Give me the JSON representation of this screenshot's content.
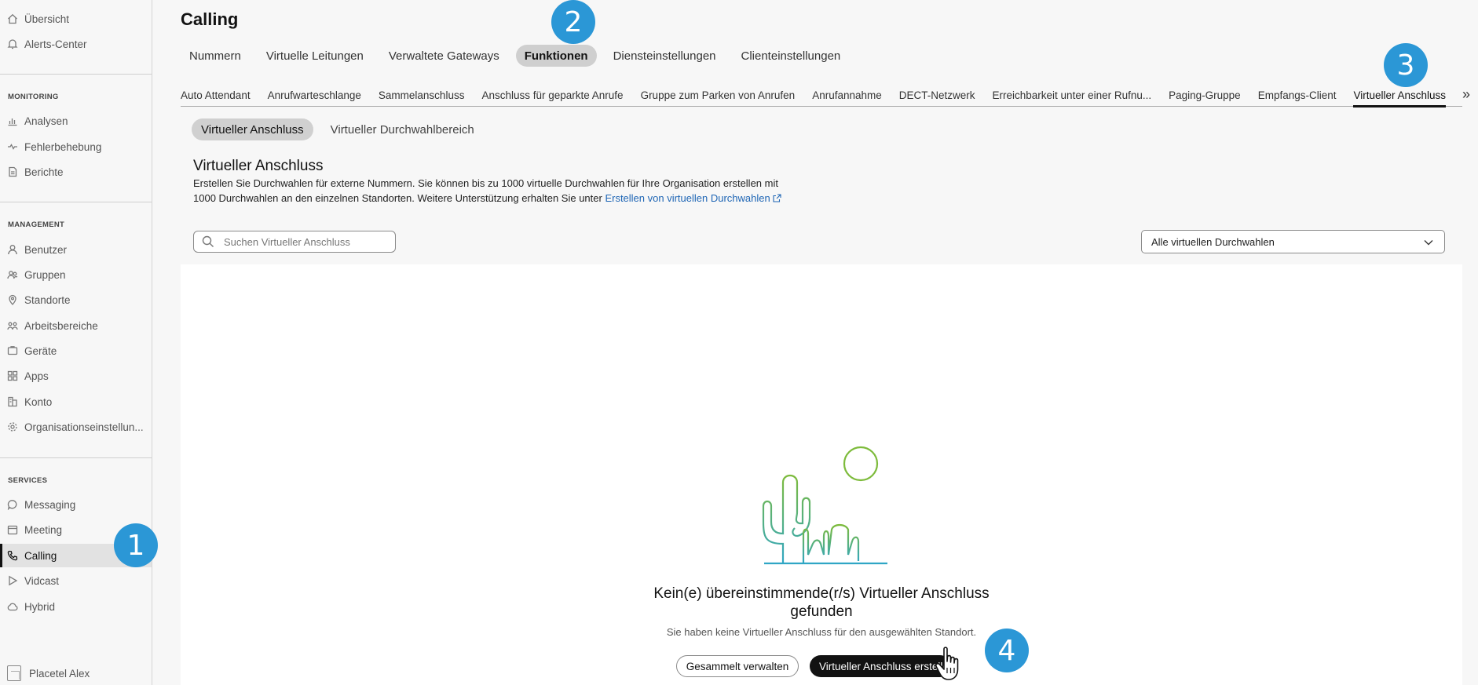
{
  "sidebar": {
    "top_items": [
      {
        "label": "Übersicht",
        "icon": "home-icon"
      },
      {
        "label": "Alerts-Center",
        "icon": "bell-icon"
      }
    ],
    "monitoring_title": "MONITORING",
    "monitoring_items": [
      {
        "label": "Analysen",
        "icon": "chart-icon"
      },
      {
        "label": "Fehlerbehebung",
        "icon": "pulse-icon"
      },
      {
        "label": "Berichte",
        "icon": "document-icon"
      }
    ],
    "management_title": "MANAGEMENT",
    "management_items": [
      {
        "label": "Benutzer",
        "icon": "user-icon"
      },
      {
        "label": "Gruppen",
        "icon": "group-icon"
      },
      {
        "label": "Standorte",
        "icon": "location-pin-icon"
      },
      {
        "label": "Arbeitsbereiche",
        "icon": "workspace-icon"
      },
      {
        "label": "Geräte",
        "icon": "device-icon"
      },
      {
        "label": "Apps",
        "icon": "apps-grid-icon"
      },
      {
        "label": "Konto",
        "icon": "account-icon"
      },
      {
        "label": "Organisationseinstellun...",
        "icon": "gear-icon"
      }
    ],
    "services_title": "SERVICES",
    "services_items": [
      {
        "label": "Messaging",
        "icon": "chat-bubble-icon"
      },
      {
        "label": "Meeting",
        "icon": "calendar-icon"
      },
      {
        "label": "Calling",
        "icon": "phone-icon",
        "active": true
      },
      {
        "label": "Vidcast",
        "icon": "play-icon"
      },
      {
        "label": "Hybrid",
        "icon": "cloud-icon"
      }
    ],
    "user_name": "Placetel Alex"
  },
  "header": {
    "title": "Calling",
    "tabs": [
      "Nummern",
      "Virtuelle Leitungen",
      "Verwaltete Gateways",
      "Funktionen",
      "Diensteinstellungen",
      "Clienteinstellungen"
    ],
    "active_tab": "Funktionen"
  },
  "feature_tabs": [
    "Auto Attendant",
    "Anrufwarteschlange",
    "Sammelanschluss",
    "Anschluss für geparkte Anrufe",
    "Gruppe zum Parken von Anrufen",
    "Anrufannahme",
    "DECT-Netzwerk",
    "Erreichbarkeit unter einer Rufnu...",
    "Paging-Gruppe",
    "Empfangs-Client",
    "Virtueller Anschluss"
  ],
  "active_feature_tab": "Virtueller Anschluss",
  "pill_tabs": [
    "Virtueller Anschluss",
    "Virtueller Durchwahlbereich"
  ],
  "section": {
    "heading": "Virtueller Anschluss",
    "desc_line1": "Erstellen Sie Durchwahlen für externe Nummern. Sie können bis zu 1000 virtuelle Durchwahlen für Ihre Organisation erstellen mit",
    "desc_line2": "1000 Durchwahlen an den einzelnen Standorten. Weitere Unterstützung erhalten Sie unter ",
    "link_text": "Erstellen von virtuellen Durchwahlen"
  },
  "search": {
    "placeholder": "Suchen Virtueller Anschluss",
    "value": ""
  },
  "filter": {
    "selected": "Alle virtuellen Durchwahlen"
  },
  "empty_state": {
    "title": "Kein(e) übereinstimmende(r/s) Virtueller Anschluss gefunden",
    "subtitle": "Sie haben keine Virtueller Anschluss für den ausgewählten Standort.",
    "btn_manage": "Gesammelt verwalten",
    "btn_create": "Virtueller Anschluss erstellen"
  },
  "badges": [
    "1",
    "2",
    "3",
    "4"
  ],
  "colors": {
    "badge": "#2b97d6",
    "link": "#1f66b5",
    "primary_button": "#121212",
    "illustration_green": "#7dbb3b",
    "illustration_teal": "#2fa6c5"
  }
}
